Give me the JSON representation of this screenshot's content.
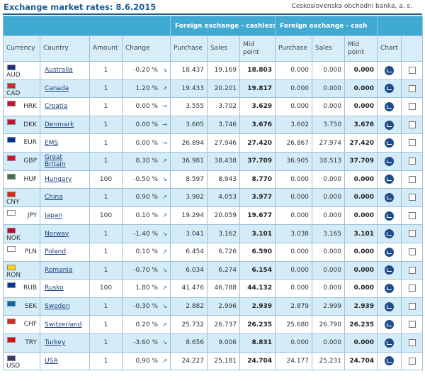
{
  "header": {
    "title": "Exchange market rates: 8.6.2015",
    "bank": "Ceskoslovenska obchodni banka, a. s."
  },
  "groups": {
    "cashless": "Foreign exchange - cashless",
    "cash": "Foreign exchange - cash"
  },
  "columns": {
    "currency": "Currency",
    "country": "Country",
    "amount": "Amount",
    "change": "Change",
    "purchase": "Purchase",
    "sales": "Sales",
    "mid_line1": "Mid",
    "mid_line2": "point",
    "chart": "Chart"
  },
  "colors": {
    "band": "#3faad2",
    "title": "#1f5b8f",
    "alt_row": "#d4ecf7"
  },
  "rows": [
    {
      "code": "AUD",
      "country": "Australia",
      "amount": "1",
      "change": "-0.20 %",
      "dir": "down",
      "p1": "18.437",
      "s1": "19.169",
      "m1": "18.803",
      "p2": "0.000",
      "s2": "0.000",
      "m2": "0.000",
      "flag_icon": "australia-flag-icon",
      "code_low": true
    },
    {
      "code": "CAD",
      "country": "Canada",
      "amount": "1",
      "change": "1.20 %",
      "dir": "up",
      "p1": "19.433",
      "s1": "20.201",
      "m1": "19.817",
      "p2": "0.000",
      "s2": "0.000",
      "m2": "0.000",
      "flag_icon": "canada-flag-icon",
      "code_low": true
    },
    {
      "code": "HRK",
      "country": "Croatia",
      "amount": "1",
      "change": "0.00 %",
      "dir": "flat",
      "p1": "3.555",
      "s1": "3.702",
      "m1": "3.629",
      "p2": "0.000",
      "s2": "0.000",
      "m2": "0.000",
      "flag_icon": "croatia-flag-icon",
      "code_low": false
    },
    {
      "code": "DKK",
      "country": "Denmark",
      "amount": "1",
      "change": "0.00 %",
      "dir": "flat",
      "p1": "3.605",
      "s1": "3.746",
      "m1": "3.676",
      "p2": "3.602",
      "s2": "3.750",
      "m2": "3.676",
      "flag_icon": "denmark-flag-icon",
      "code_low": false
    },
    {
      "code": "EUR",
      "country": "EMS",
      "amount": "1",
      "change": "0.00 %",
      "dir": "flat",
      "p1": "26.894",
      "s1": "27.946",
      "m1": "27.420",
      "p2": "26.867",
      "s2": "27.974",
      "m2": "27.420",
      "flag_icon": "eu-flag-icon",
      "code_low": false
    },
    {
      "code": "GBP",
      "country": "Great Britain",
      "country_l1": "Great",
      "country_l2": "Britain",
      "amount": "1",
      "change": "0.30 %",
      "dir": "up",
      "p1": "36.981",
      "s1": "38.438",
      "m1": "37.709",
      "p2": "36.905",
      "s2": "38.513",
      "m2": "37.709",
      "flag_icon": "uk-flag-icon",
      "code_low": false
    },
    {
      "code": "HUF",
      "country": "Hungary",
      "amount": "100",
      "change": "-0.50 %",
      "dir": "down",
      "p1": "8.597",
      "s1": "8.943",
      "m1": "8.770",
      "p2": "0.000",
      "s2": "0.000",
      "m2": "0.000",
      "flag_icon": "hungary-flag-icon",
      "code_low": false
    },
    {
      "code": "CNY",
      "country": "China",
      "amount": "1",
      "change": "0.90 %",
      "dir": "up",
      "p1": "3.902",
      "s1": "4.053",
      "m1": "3.977",
      "p2": "0.000",
      "s2": "0.000",
      "m2": "0.000",
      "flag_icon": "china-flag-icon",
      "code_low": true
    },
    {
      "code": "JPY",
      "country": "Japan",
      "amount": "100",
      "change": "0.10 %",
      "dir": "up",
      "p1": "19.294",
      "s1": "20.059",
      "m1": "19.677",
      "p2": "0.000",
      "s2": "0.000",
      "m2": "0.000",
      "flag_icon": "japan-flag-icon",
      "code_low": false
    },
    {
      "code": "NOK",
      "country": "Norway",
      "amount": "1",
      "change": "-1.40 %",
      "dir": "down",
      "p1": "3.041",
      "s1": "3.162",
      "m1": "3.101",
      "p2": "3.038",
      "s2": "3.165",
      "m2": "3.101",
      "flag_icon": "norway-flag-icon",
      "code_low": true
    },
    {
      "code": "PLN",
      "country": "Poland",
      "amount": "1",
      "change": "0.10 %",
      "dir": "up",
      "p1": "6.454",
      "s1": "6.726",
      "m1": "6.590",
      "p2": "0.000",
      "s2": "0.000",
      "m2": "0.000",
      "flag_icon": "poland-flag-icon",
      "code_low": false
    },
    {
      "code": "RON",
      "country": "Romania",
      "amount": "1",
      "change": "-0.70 %",
      "dir": "down",
      "p1": "6.034",
      "s1": "6.274",
      "m1": "6.154",
      "p2": "0.000",
      "s2": "0.000",
      "m2": "0.000",
      "flag_icon": "romania-flag-icon",
      "code_low": true
    },
    {
      "code": "RUB",
      "country": "Rusko",
      "amount": "100",
      "change": "1.80 %",
      "dir": "up",
      "p1": "41.476",
      "s1": "46.788",
      "m1": "44.132",
      "p2": "0.000",
      "s2": "0.000",
      "m2": "0.000",
      "flag_icon": "russia-flag-icon",
      "code_low": false
    },
    {
      "code": "SEK",
      "country": "Sweden",
      "amount": "1",
      "change": "-0.30 %",
      "dir": "down",
      "p1": "2.882",
      "s1": "2.996",
      "m1": "2.939",
      "p2": "2.879",
      "s2": "2.999",
      "m2": "2.939",
      "flag_icon": "sweden-flag-icon",
      "code_low": false
    },
    {
      "code": "CHF",
      "country": "Switzerland",
      "amount": "1",
      "change": "0.20 %",
      "dir": "up",
      "p1": "25.732",
      "s1": "26.737",
      "m1": "26.235",
      "p2": "25.680",
      "s2": "26.790",
      "m2": "26.235",
      "flag_icon": "switzerland-flag-icon",
      "code_low": false
    },
    {
      "code": "TRY",
      "country": "Turkey",
      "amount": "1",
      "change": "-3.60 %",
      "dir": "down",
      "p1": "8.656",
      "s1": "9.006",
      "m1": "8.831",
      "p2": "0.000",
      "s2": "0.000",
      "m2": "0.000",
      "flag_icon": "turkey-flag-icon",
      "code_low": false
    },
    {
      "code": "USD",
      "country": "USA",
      "amount": "1",
      "change": "0.90 %",
      "dir": "up",
      "p1": "24.227",
      "s1": "25.181",
      "m1": "24.704",
      "p2": "24.177",
      "s2": "25.231",
      "m2": "24.704",
      "flag_icon": "usa-flag-icon",
      "code_low": true
    }
  ]
}
